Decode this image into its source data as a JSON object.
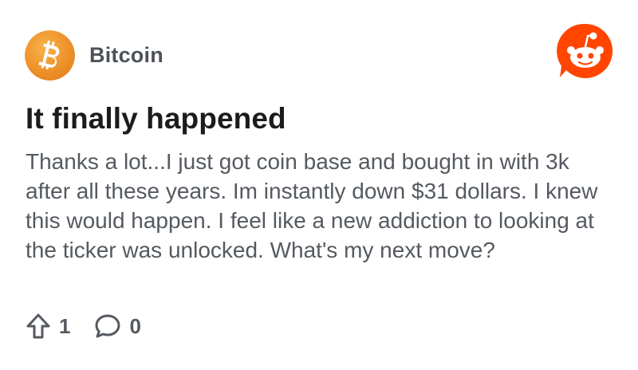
{
  "colors": {
    "bitcoin_orange": "#f39a2b",
    "reddit_orange": "#ff4500",
    "title_text": "#1c1c1c",
    "body_text": "#555a60"
  },
  "icons": {
    "subreddit_avatar": "bitcoin-icon",
    "brand_logo": "reddit-logo-icon",
    "upvote": "upvote-arrow-icon",
    "comments": "comment-bubble-icon"
  },
  "subreddit": {
    "name": "Bitcoin"
  },
  "post": {
    "title": "It finally happened",
    "body": "Thanks a lot...I just got coin base and bought in with 3k after all these years. Im instantly down $31 dollars. I knew this would happen. I feel like a new addiction to looking at the ticker was unlocked. What's my next move?",
    "upvotes": "1",
    "comments": "0"
  }
}
